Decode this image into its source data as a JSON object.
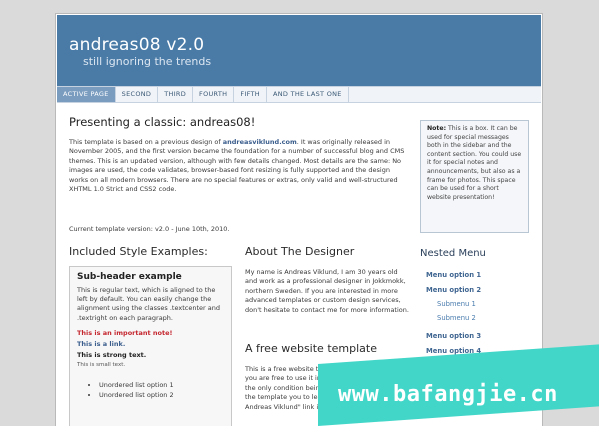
{
  "header": {
    "title": "andreas08 v2.0",
    "slogan": "still ignoring the trends"
  },
  "nav": [
    {
      "label": "ACTIVE PAGE",
      "active": true
    },
    {
      "label": "SECOND"
    },
    {
      "label": "THIRD"
    },
    {
      "label": "FOURTH"
    },
    {
      "label": "FIFTH"
    },
    {
      "label": "AND THE LAST ONE"
    }
  ],
  "main": {
    "title": "Presenting a classic: andreas08!",
    "para1_pre": "This template is based on a previous design of ",
    "para1_link": "andreasviklund.com",
    "para1_post": ". It was originally released in November 2005, and the first version became the foundation for a number of successful blog and CMS themes. This is an updated version, although with few details changed. Most details are the same: No images are used, the code validates, browser-based font resizing is fully supported and the design works on all modern browsers. There are no special features or extras, only valid and well-structured XHTML 1.0 Strict and CSS2 code.",
    "version": "Current template version: v2.0 - June 10th, 2010."
  },
  "notebox": {
    "label": "Note:",
    "text": " This is a box. It can be used for special messages both in the sidebar and the content section. You could use it for special notes and announcements, but also as a frame for photos. This space can be used for a short website presentation!"
  },
  "styles": {
    "heading": "Included Style Examples:",
    "subheader": "Sub-header example",
    "text": "This is regular text, which is aligned to the left by default. You can easily change the alignment using the classes .textcenter and .textright on each paragraph.",
    "important": "This is an important note!",
    "link": "This is a link.",
    "strong": "This is strong text.",
    "small": "This is small text.",
    "list_items": [
      "Unordered list option 1",
      "Unordered list option 2"
    ]
  },
  "about": {
    "heading": "About The Designer",
    "text": "My name is Andreas Viklund, I am 30 years old and work as a professional designer in Jokkmokk, northern Sweden. If you are interested in more advanced templates or custom design services, don't hesitate to contact me for more information.",
    "free_heading": "A free website template",
    "free_text": "This is a free website template which means that you are free to use it in any way you want to with the only condition being that you decide to use the template you to leave the \"Original design by Andreas Viklund\" link in the footer. But it is"
  },
  "sidebar": {
    "menu_title": "Nested Menu",
    "items": [
      {
        "label": "Menu option 1"
      },
      {
        "label": "Menu option 2"
      },
      {
        "label": "Submenu 1"
      },
      {
        "label": "Submenu 2"
      },
      {
        "label": "Menu option 3"
      },
      {
        "label": "Menu option 4"
      }
    ]
  },
  "watermark": {
    "text": "www.bafangjie.cn"
  },
  "colors": {
    "header_bg": "#4a7ba7",
    "nav_active_bg": "#7a9cbf",
    "link": "#3a5d8c",
    "important": "#c4262e",
    "watermark_bg": "#42d6c8"
  }
}
